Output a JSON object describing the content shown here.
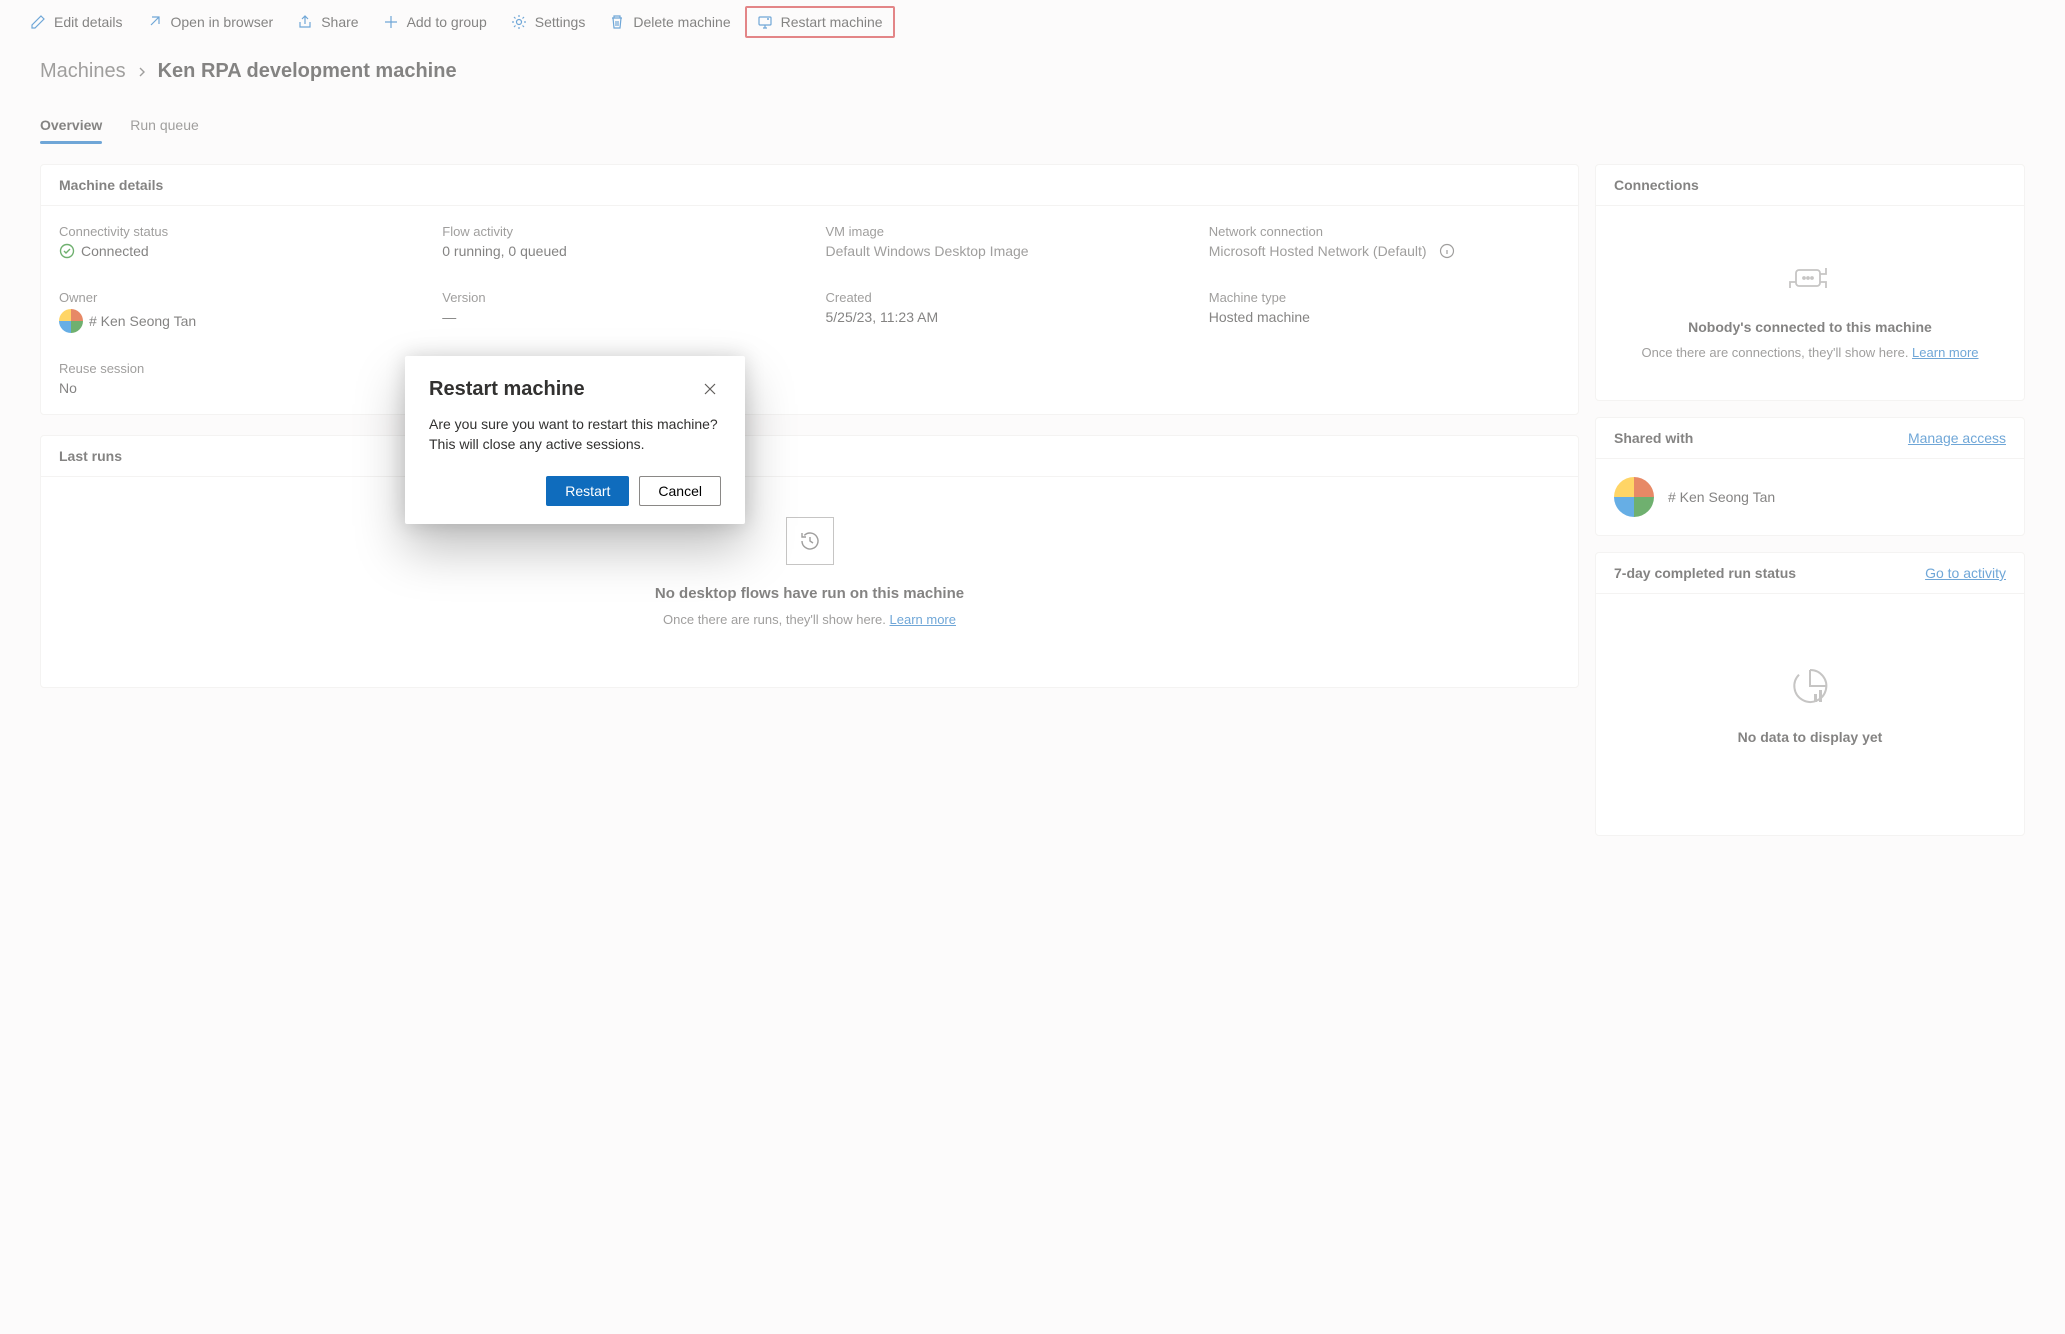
{
  "commandBar": {
    "editDetails": "Edit details",
    "openInBrowser": "Open in browser",
    "share": "Share",
    "addToGroup": "Add to group",
    "settings": "Settings",
    "deleteMachine": "Delete machine",
    "restartMachine": "Restart machine"
  },
  "breadcrumb": {
    "root": "Machines",
    "title": "Ken RPA development machine"
  },
  "tabs": {
    "overview": "Overview",
    "runQueue": "Run queue"
  },
  "machineDetails": {
    "header": "Machine details",
    "connectivityStatus": {
      "label": "Connectivity status",
      "value": "Connected"
    },
    "flowActivity": {
      "label": "Flow activity",
      "value": "0 running, 0 queued"
    },
    "vmImage": {
      "label": "VM image",
      "value": "Default Windows Desktop Image"
    },
    "networkConnection": {
      "label": "Network connection",
      "value": "Microsoft Hosted Network (Default)"
    },
    "owner": {
      "label": "Owner",
      "value": "# Ken Seong Tan"
    },
    "version": {
      "label": "Version",
      "value": "—"
    },
    "created": {
      "label": "Created",
      "value": "5/25/23, 11:23 AM"
    },
    "machineType": {
      "label": "Machine type",
      "value": "Hosted machine"
    },
    "reuseSession": {
      "label": "Reuse session",
      "value": "No"
    }
  },
  "lastRuns": {
    "header": "Last runs",
    "emptyTitle": "No desktop flows have run on this machine",
    "emptySub": "Once there are runs, they'll show here. ",
    "learnMore": "Learn more"
  },
  "connections": {
    "header": "Connections",
    "emptyTitle": "Nobody's connected to this machine",
    "emptySub": "Once there are connections, they'll show here. ",
    "learnMore": "Learn more"
  },
  "sharedWith": {
    "header": "Shared with",
    "manage": "Manage access",
    "userName": "# Ken Seong Tan"
  },
  "runStatus": {
    "header": "7-day completed run status",
    "link": "Go to activity",
    "noData": "No data to display yet"
  },
  "dialog": {
    "title": "Restart machine",
    "body": "Are you sure you want to restart this machine? This will close any active sessions.",
    "primary": "Restart",
    "secondary": "Cancel"
  }
}
